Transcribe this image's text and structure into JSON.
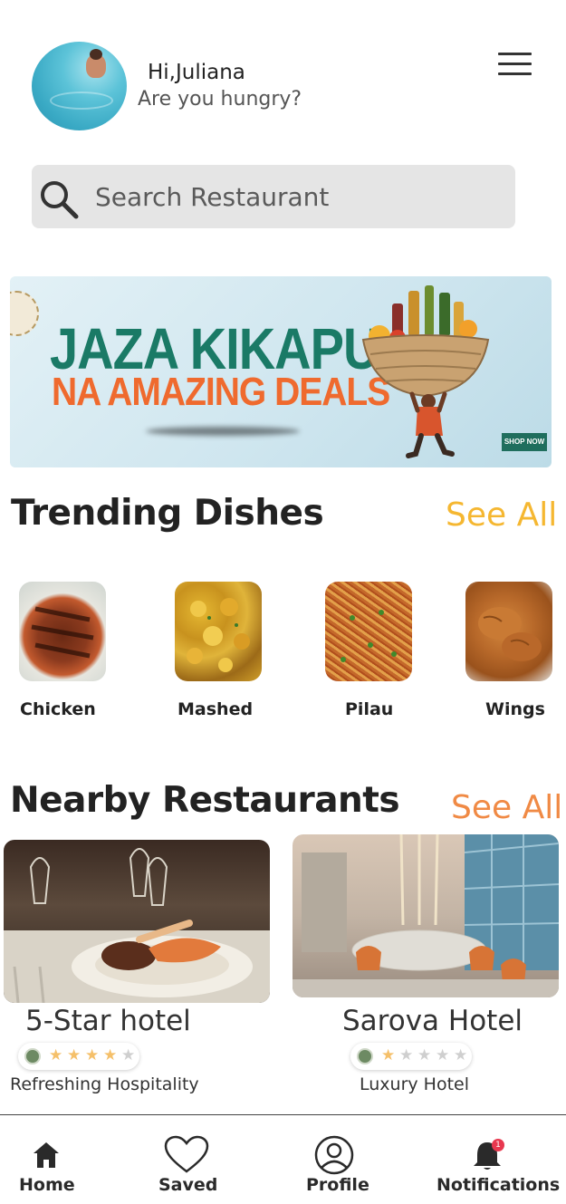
{
  "header": {
    "greeting": "Hi,Juliana",
    "subtitle": "Are you hungry?",
    "menu_icon": "hamburger-menu-icon"
  },
  "search": {
    "placeholder": "Search Restaurant",
    "icon": "search-icon"
  },
  "banner": {
    "line1": "JAZA KIKAPU",
    "line2": "NA AMAZING DEALS",
    "cta": "SHOP NOW"
  },
  "trending": {
    "title": "Trending Dishes",
    "see_all": "See All",
    "see_all_color": "#f5b731",
    "dishes": [
      {
        "label": "Chicken"
      },
      {
        "label": "Mashed"
      },
      {
        "label": "Pilau"
      },
      {
        "label": "Wings"
      }
    ]
  },
  "nearby": {
    "title": "Nearby Restaurants",
    "see_all": "See All",
    "see_all_color": "#f08a45",
    "restaurants": [
      {
        "name": "5-Star hotel",
        "rating": 4,
        "max_rating": 5,
        "description": "Refreshing Hospitality"
      },
      {
        "name": "Sarova Hotel",
        "rating": 1,
        "max_rating": 5,
        "description": "Luxury Hotel"
      }
    ]
  },
  "tabs": [
    {
      "label": "Home",
      "icon": "home-icon",
      "active": true
    },
    {
      "label": "Saved",
      "icon": "heart-icon"
    },
    {
      "label": "Profile",
      "icon": "user-icon"
    },
    {
      "label": "Notifications",
      "icon": "bell-icon",
      "badge": "1"
    }
  ],
  "colors": {
    "star_filled": "#f5c06a",
    "star_empty": "#cfcfcf",
    "badge": "#e8384f"
  }
}
